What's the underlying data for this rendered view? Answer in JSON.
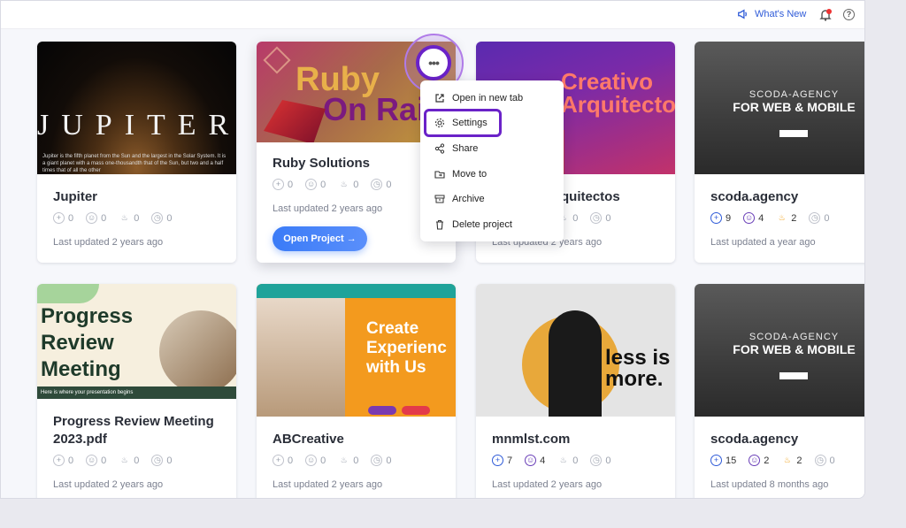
{
  "topbar": {
    "whats_new": "What's New",
    "help": "?"
  },
  "cards": [
    {
      "title": "Jupiter",
      "stats": [
        "0",
        "0",
        "0",
        "0"
      ],
      "updated": "Last updated 2 years ago",
      "thumb_text": "JUPITER",
      "thumb_caption": "Jupiter is the fifth planet from the Sun and the largest in the Solar System. It is a giant planet with a mass one-thousandth that of the Sun, but two and a half times that of all the other"
    },
    {
      "title": "Ruby Solutions",
      "stats": [
        "0",
        "0",
        "0",
        "0"
      ],
      "updated": "Last updated 2 years ago",
      "thumb_text1": "Ruby",
      "thumb_text2": "On Rails",
      "open_label": "Open Project →"
    },
    {
      "title": "Creativo Arquitectos",
      "title_visible": "quitectos",
      "stats": [
        "0",
        "0",
        "0",
        "0"
      ],
      "updated": "Last updated 2 years ago",
      "thumb_text1": "Creativo",
      "thumb_text2": "Arquitecto"
    },
    {
      "title": "scoda.agency",
      "stats": [
        "9",
        "4",
        "2",
        "0"
      ],
      "updated": "Last updated a year ago",
      "thumb_text1": "SCODA-AGENCY",
      "thumb_text2": "FOR WEB & MOBILE"
    },
    {
      "title": "Progress Review Meeting 2023.pdf",
      "title_line1": "Progress Review Meeting",
      "title_line2": "2023.pdf",
      "stats": [
        "0",
        "0",
        "0",
        "0"
      ],
      "updated": "Last updated 2 years ago",
      "thumb_text1": "Progress",
      "thumb_text2": "Review",
      "thumb_text3": "Meeting",
      "thumb_caption": "Here is where your presentation begins"
    },
    {
      "title": "ABCreative",
      "stats": [
        "0",
        "0",
        "0",
        "0"
      ],
      "updated": "Last updated 2 years ago",
      "thumb_text1": "Create",
      "thumb_text2": "Experienc",
      "thumb_text3": "with Us"
    },
    {
      "title": "mnmlst.com",
      "stats": [
        "7",
        "4",
        "0",
        "0"
      ],
      "updated": "Last updated 2 years ago",
      "thumb_text1": "less is",
      "thumb_text2": "more."
    },
    {
      "title": "scoda.agency",
      "stats": [
        "15",
        "2",
        "2",
        "0"
      ],
      "updated": "Last updated 8 months ago",
      "thumb_text1": "SCODA-AGENCY",
      "thumb_text2": "FOR WEB & MOBILE"
    }
  ],
  "menu": {
    "items": [
      "Open in new tab",
      "Settings",
      "Share",
      "Move to",
      "Archive",
      "Delete project"
    ],
    "more": "•••"
  },
  "colors": {
    "accent": "#3a7bf7",
    "purple": "#6a22c8",
    "stat_blue": "#2f5bd8",
    "stat_purple": "#6a3fb8",
    "stat_orange": "#f0a21a"
  }
}
